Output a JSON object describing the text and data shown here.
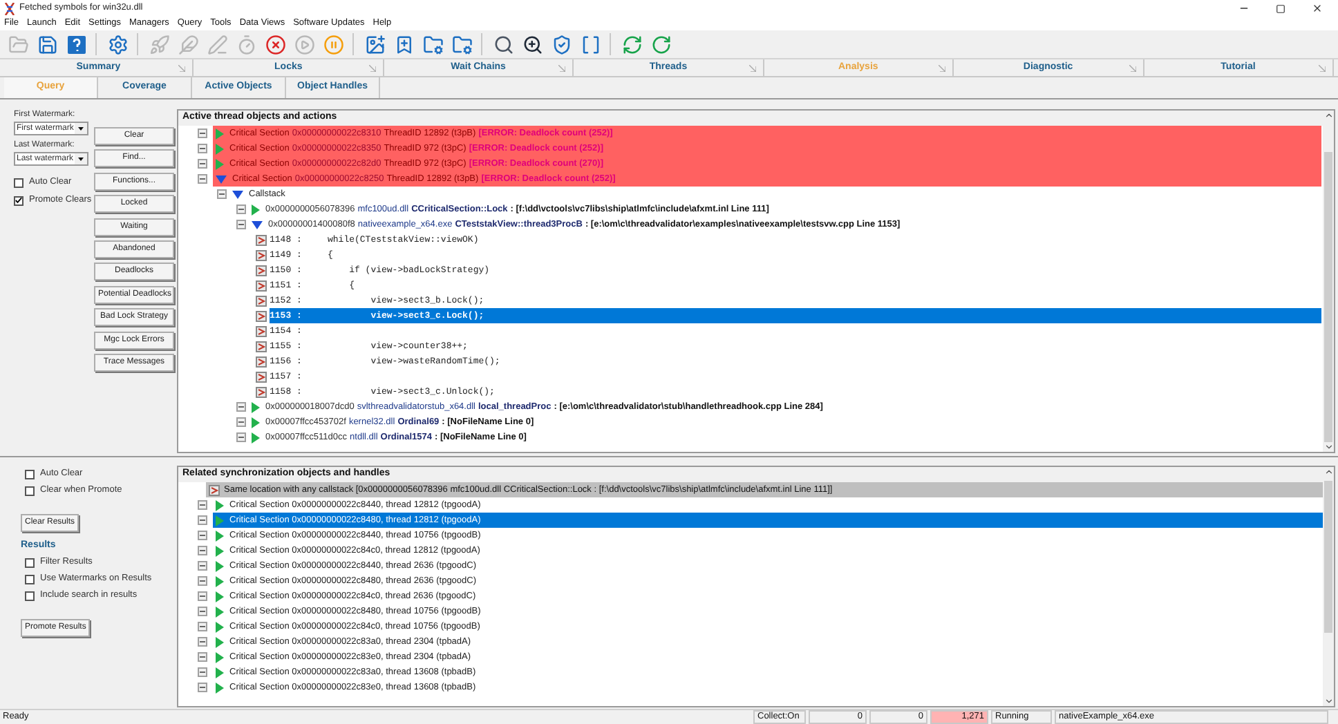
{
  "window": {
    "title": "Fetched symbols for win32u.dll"
  },
  "menu": [
    "File",
    "Launch",
    "Edit",
    "Settings",
    "Managers",
    "Query",
    "Tools",
    "Data Views",
    "Software Updates",
    "Help"
  ],
  "toolbar": [
    [
      {
        "disabled": true
      },
      {
        "disabled": false
      },
      {
        "disabled": false
      }
    ],
    [
      {
        "disabled": false
      }
    ],
    [
      {
        "disabled": true
      },
      {
        "disabled": true
      },
      {
        "disabled": true
      },
      {
        "disabled": true
      },
      {
        "disabled": false
      },
      {
        "disabled": true
      },
      {
        "disabled": false
      }
    ],
    [
      {
        "disabled": false
      },
      {
        "disabled": false
      },
      {
        "disabled": false
      },
      {
        "disabled": false
      }
    ],
    [
      {
        "disabled": false
      },
      {
        "disabled": false
      },
      {
        "disabled": false
      },
      {
        "disabled": false
      }
    ],
    [
      {
        "disabled": false
      },
      {
        "disabled": false
      }
    ]
  ],
  "main_tabs": [
    {
      "label": "Summary",
      "selected": false
    },
    {
      "label": "Locks",
      "selected": false
    },
    {
      "label": "Wait Chains",
      "selected": false
    },
    {
      "label": "Threads",
      "selected": false
    },
    {
      "label": "Analysis",
      "selected": true
    },
    {
      "label": "Diagnostic",
      "selected": false
    },
    {
      "label": "Tutorial",
      "selected": false
    }
  ],
  "sub_tabs": [
    {
      "label": "Query",
      "selected": true
    },
    {
      "label": "Coverage",
      "selected": false
    },
    {
      "label": "Active Objects",
      "selected": false
    },
    {
      "label": "Object Handles",
      "selected": false
    }
  ],
  "query_panel": {
    "watermarks": [
      {
        "label": "First Watermark:",
        "value": "First watermark"
      },
      {
        "label": "Last Watermark:",
        "value": "Last watermark"
      }
    ],
    "options": [
      {
        "label": "Auto Clear",
        "checked": false
      },
      {
        "label": "Promote Clears",
        "checked": true
      }
    ],
    "buttons": [
      "Clear",
      "Find...",
      "Functions...",
      "Locked",
      "Waiting",
      "Abandoned",
      "Deadlocks",
      "Potential Deadlocks",
      "Bad Lock Strategy",
      "Mgc Lock Errors",
      "Trace Messages"
    ]
  },
  "thread_objects": {
    "title": "Active thread objects and actions",
    "items": [
      {
        "kind": "error",
        "label": "Critical Section",
        "address": "0x00000000022c8310",
        "thread": "ThreadID 12892 (t3pB)",
        "error": "[ERROR: Deadlock count (252)]",
        "expanded": false
      },
      {
        "kind": "error",
        "label": "Critical Section",
        "address": "0x00000000022c8350",
        "thread": "ThreadID 972 (t3pC)",
        "error": "[ERROR: Deadlock count (252)]",
        "expanded": false
      },
      {
        "kind": "error",
        "label": "Critical Section",
        "address": "0x00000000022c82d0",
        "thread": "ThreadID 972 (t3pC)",
        "error": "[ERROR: Deadlock count (270)]",
        "expanded": false
      },
      {
        "kind": "error",
        "label": "Critical Section",
        "address": "0x00000000022c8250",
        "thread": "ThreadID 12892 (t3pB)",
        "error": "[ERROR: Deadlock count (252)]",
        "expanded": true,
        "children": [
          {
            "kind": "group",
            "label": "Callstack",
            "expanded": true,
            "children": [
              {
                "kind": "frame",
                "address": "0x0000000056078396",
                "module": "mfc100ud.dll",
                "function": "CCriticalSection::Lock",
                "location": ": [f:\\dd\\vctools\\vc7libs\\ship\\atlmfc\\include\\afxmt.inl Line 111]",
                "expanded": false
              },
              {
                "kind": "frame",
                "address": "0x00000001400080f8",
                "module": "nativeexample_x64.exe",
                "function": "CTeststakView::thread3ProcB",
                "location": ": [e:\\om\\c\\threadvalidator\\examples\\nativeexample\\testsvw.cpp Line 1153]",
                "expanded": true,
                "children": [
                  {
                    "kind": "line",
                    "number": "1148 :",
                    "code": "while(CTeststakView::viewOK)",
                    "selected": false
                  },
                  {
                    "kind": "line",
                    "number": "1149 :",
                    "code": "{",
                    "selected": false
                  },
                  {
                    "kind": "line",
                    "number": "1150 :",
                    "code": "    if (view->badLockStrategy)",
                    "selected": false
                  },
                  {
                    "kind": "line",
                    "number": "1151 :",
                    "code": "    {",
                    "selected": false
                  },
                  {
                    "kind": "line",
                    "number": "1152 :",
                    "code": "        view->sect3_b.Lock();",
                    "selected": false
                  },
                  {
                    "kind": "line",
                    "number": "1153 :",
                    "code": "        view->sect3_c.Lock();",
                    "selected": true
                  },
                  {
                    "kind": "line",
                    "number": "1154 :",
                    "selected": false
                  },
                  {
                    "kind": "line",
                    "number": "1155 :",
                    "code": "        view->counter38++;",
                    "selected": false
                  },
                  {
                    "kind": "line",
                    "number": "1156 :",
                    "code": "        view->wasteRandomTime();",
                    "selected": false
                  },
                  {
                    "kind": "line",
                    "number": "1157 :",
                    "selected": false
                  },
                  {
                    "kind": "line",
                    "number": "1158 :",
                    "code": "        view->sect3_c.Unlock();",
                    "selected": false
                  }
                ]
              },
              {
                "kind": "frame",
                "address": "0x000000018007dcd0",
                "module": "svlthreadvalidatorstub_x64.dll",
                "function": "local_threadProc",
                "location": ": [e:\\om\\c\\threadvalidator\\stub\\handlethreadhook.cpp Line 284]",
                "expanded": false
              },
              {
                "kind": "frame",
                "address": "0x00007ffcc453702f",
                "module": "kernel32.dll",
                "function": "Ordinal69",
                "location": ": [NoFileName Line 0]",
                "expanded": false
              },
              {
                "kind": "frame",
                "address": "0x00007ffcc511d0cc",
                "module": "ntdll.dll",
                "function": "Ordinal1574",
                "location": ": [NoFileName Line 0]",
                "expanded": false
              }
            ]
          }
        ]
      }
    ]
  },
  "results_panel": {
    "options": [
      {
        "label": "Auto Clear",
        "checked": false
      },
      {
        "label": "Clear when Promote",
        "checked": false
      }
    ],
    "clear_button": "Clear Results",
    "heading": "Results",
    "filters": [
      {
        "label": "Filter Results",
        "checked": false
      },
      {
        "label": "Use Watermarks on Results",
        "checked": false
      },
      {
        "label": "Include search in results",
        "checked": false
      }
    ],
    "promote_button": "Promote Results"
  },
  "related_objects": {
    "title": "Related synchronization objects and handles",
    "header": "Same location with any callstack [0x0000000056078396 mfc100ud.dll CCriticalSection::Lock : [f:\\dd\\vctools\\vc7libs\\ship\\atlmfc\\include\\afxmt.inl Line 111]]",
    "items": [
      {
        "label": "Critical Section 0x00000000022c8440, thread 12812 (tpgoodA)",
        "selected": false
      },
      {
        "label": "Critical Section 0x00000000022c8480, thread 12812 (tpgoodA)",
        "selected": true
      },
      {
        "label": "Critical Section 0x00000000022c8440, thread 10756 (tpgoodB)",
        "selected": false
      },
      {
        "label": "Critical Section 0x00000000022c84c0, thread 12812 (tpgoodA)",
        "selected": false
      },
      {
        "label": "Critical Section 0x00000000022c8440, thread 2636 (tpgoodC)",
        "selected": false
      },
      {
        "label": "Critical Section 0x00000000022c8480, thread 2636 (tpgoodC)",
        "selected": false
      },
      {
        "label": "Critical Section 0x00000000022c84c0, thread 2636 (tpgoodC)",
        "selected": false
      },
      {
        "label": "Critical Section 0x00000000022c8480, thread 10756 (tpgoodB)",
        "selected": false
      },
      {
        "label": "Critical Section 0x00000000022c84c0, thread 10756 (tpgoodB)",
        "selected": false
      },
      {
        "label": "Critical Section 0x00000000022c83a0, thread 2304 (tpbadA)",
        "selected": false
      },
      {
        "label": "Critical Section 0x00000000022c83e0, thread 2304 (tpbadA)",
        "selected": false
      },
      {
        "label": "Critical Section 0x00000000022c83a0, thread 13608 (tpbadB)",
        "selected": false
      },
      {
        "label": "Critical Section 0x00000000022c83e0, thread 13608 (tpbadB)",
        "selected": false
      }
    ]
  },
  "status_bar": {
    "message": "Ready",
    "fields": [
      {
        "kind": "text",
        "text": "Collect:On",
        "highlighted": false
      },
      {
        "kind": "number",
        "text": "0",
        "highlighted": false
      },
      {
        "kind": "number",
        "text": "0",
        "highlighted": false
      },
      {
        "kind": "number",
        "text": "1,271",
        "highlighted": true
      },
      {
        "kind": "text",
        "text": "Running",
        "highlighted": false
      },
      {
        "kind": "text",
        "text": "nativeExample_x64.exe",
        "highlighted": false
      }
    ]
  }
}
